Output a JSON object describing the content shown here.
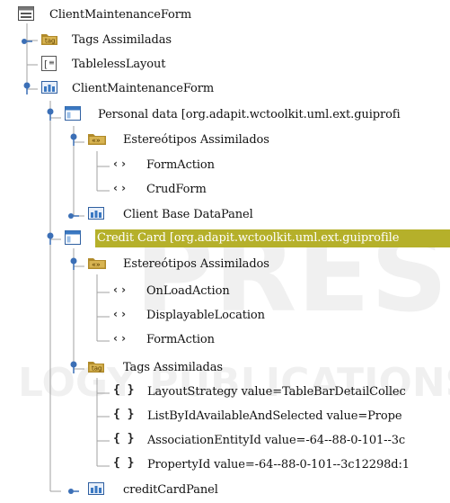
{
  "watermark": {
    "big": "PRESS",
    "small": "LOGY PUBLICATIONS"
  },
  "tree": {
    "nodes": [
      {
        "label": "ClientMaintenanceForm",
        "icon": "form-icon"
      },
      {
        "label": "Tags Assimiladas",
        "icon": "tag-folder-icon"
      },
      {
        "label": "TablelessLayout",
        "icon": "layout-icon"
      },
      {
        "label": "ClientMaintenanceForm",
        "icon": "panel-icon"
      },
      {
        "label": "Personal data [org.adapit.wctoolkit.uml.ext.guiprofi",
        "icon": "panel-outline-icon"
      },
      {
        "label": "Estereótipos Assimilados",
        "icon": "stereotype-folder-icon"
      },
      {
        "label": "FormAction",
        "icon": "stereotype-icon"
      },
      {
        "label": "CrudForm",
        "icon": "stereotype-icon"
      },
      {
        "label": "Client Base DataPanel",
        "icon": "panel-icon"
      },
      {
        "label": "Credit Card [org.adapit.wctoolkit.uml.ext.guiprofile",
        "icon": "panel-outline-icon",
        "selected": true
      },
      {
        "label": "Estereótipos Assimilados",
        "icon": "stereotype-folder-icon"
      },
      {
        "label": "OnLoadAction",
        "icon": "stereotype-icon"
      },
      {
        "label": "DisplayableLocation",
        "icon": "stereotype-icon"
      },
      {
        "label": "FormAction",
        "icon": "stereotype-icon"
      },
      {
        "label": "Tags Assimiladas",
        "icon": "tag-folder-icon"
      },
      {
        "label": "LayoutStrategy value=TableBarDetailCollec",
        "icon": "tag-value-icon"
      },
      {
        "label": "ListByIdAvailableAndSelected value=Prope",
        "icon": "tag-value-icon"
      },
      {
        "label": "AssociationEntityId value=-64--88-0-101--3c",
        "icon": "tag-value-icon"
      },
      {
        "label": "PropertyId value=-64--88-0-101--3c12298d:1",
        "icon": "tag-value-icon"
      },
      {
        "label": "creditCardPanel",
        "icon": "panel-icon"
      }
    ]
  },
  "colors": {
    "selection": "#b5b02a",
    "panelIcon": "#3a78c2",
    "folderIcon": "#b08a2a",
    "treeLine": "#9a9a9a",
    "handle": "#3b6fb6"
  }
}
